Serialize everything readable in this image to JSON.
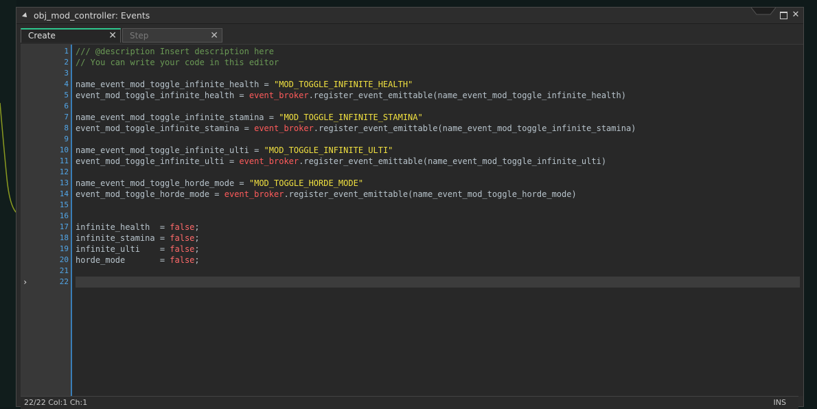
{
  "window": {
    "title": "obj_mod_controller: Events"
  },
  "tabs": [
    {
      "label": "Create",
      "close": "✕",
      "active": true
    },
    {
      "label": "Step",
      "close": "✕",
      "active": false
    }
  ],
  "editor": {
    "current_line_marker": "›",
    "lines": [
      {
        "n": "1",
        "tokens": [
          {
            "t": "/// @description Insert description here",
            "k": "comment"
          }
        ]
      },
      {
        "n": "2",
        "tokens": [
          {
            "t": "// You can write your code in this editor",
            "k": "comment"
          }
        ]
      },
      {
        "n": "3",
        "tokens": []
      },
      {
        "n": "4",
        "tokens": [
          {
            "t": "name_event_mod_toggle_infinite_health = ",
            "k": "var"
          },
          {
            "t": "\"MOD_TOGGLE_INFINITE_HEALTH\"",
            "k": "str"
          }
        ]
      },
      {
        "n": "5",
        "tokens": [
          {
            "t": "event_mod_toggle_infinite_health = ",
            "k": "var"
          },
          {
            "t": "event_broker",
            "k": "obj"
          },
          {
            "t": ".register_event_emittable(name_event_mod_toggle_infinite_health)",
            "k": "var"
          }
        ]
      },
      {
        "n": "6",
        "tokens": []
      },
      {
        "n": "7",
        "tokens": [
          {
            "t": "name_event_mod_toggle_infinite_stamina = ",
            "k": "var"
          },
          {
            "t": "\"MOD_TOGGLE_INFINITE_STAMINA\"",
            "k": "str"
          }
        ]
      },
      {
        "n": "8",
        "tokens": [
          {
            "t": "event_mod_toggle_infinite_stamina = ",
            "k": "var"
          },
          {
            "t": "event_broker",
            "k": "obj"
          },
          {
            "t": ".register_event_emittable(name_event_mod_toggle_infinite_stamina)",
            "k": "var"
          }
        ]
      },
      {
        "n": "9",
        "tokens": []
      },
      {
        "n": "10",
        "tokens": [
          {
            "t": "name_event_mod_toggle_infinite_ulti = ",
            "k": "var"
          },
          {
            "t": "\"MOD_TOGGLE_INFINITE_ULTI\"",
            "k": "str"
          }
        ]
      },
      {
        "n": "11",
        "tokens": [
          {
            "t": "event_mod_toggle_infinite_ulti = ",
            "k": "var"
          },
          {
            "t": "event_broker",
            "k": "obj"
          },
          {
            "t": ".register_event_emittable(name_event_mod_toggle_infinite_ulti)",
            "k": "var"
          }
        ]
      },
      {
        "n": "12",
        "tokens": []
      },
      {
        "n": "13",
        "tokens": [
          {
            "t": "name_event_mod_toggle_horde_mode = ",
            "k": "var"
          },
          {
            "t": "\"MOD_TOGGLE_HORDE_MODE\"",
            "k": "str"
          }
        ]
      },
      {
        "n": "14",
        "tokens": [
          {
            "t": "event_mod_toggle_horde_mode = ",
            "k": "var"
          },
          {
            "t": "event_broker",
            "k": "obj"
          },
          {
            "t": ".register_event_emittable(name_event_mod_toggle_horde_mode)",
            "k": "var"
          }
        ]
      },
      {
        "n": "15",
        "tokens": []
      },
      {
        "n": "16",
        "tokens": []
      },
      {
        "n": "17",
        "tokens": [
          {
            "t": "infinite_health  = ",
            "k": "var"
          },
          {
            "t": "false",
            "k": "kw"
          },
          {
            "t": ";",
            "k": "var"
          }
        ]
      },
      {
        "n": "18",
        "tokens": [
          {
            "t": "infinite_stamina = ",
            "k": "var"
          },
          {
            "t": "false",
            "k": "kw"
          },
          {
            "t": ";",
            "k": "var"
          }
        ]
      },
      {
        "n": "19",
        "tokens": [
          {
            "t": "infinite_ulti    = ",
            "k": "var"
          },
          {
            "t": "false",
            "k": "kw"
          },
          {
            "t": ";",
            "k": "var"
          }
        ]
      },
      {
        "n": "20",
        "tokens": [
          {
            "t": "horde_mode       = ",
            "k": "var"
          },
          {
            "t": "false",
            "k": "kw"
          },
          {
            "t": ";",
            "k": "var"
          }
        ]
      },
      {
        "n": "21",
        "tokens": []
      },
      {
        "n": "22",
        "tokens": [],
        "current": true
      }
    ]
  },
  "status": {
    "position": "22/22 Col:1 Ch:1",
    "mode": "INS"
  },
  "colors": {
    "accent_tab": "#2ec78e",
    "line_numbers": "#52a6e8",
    "string": "#f0e040",
    "keyword": "#ff6a6a",
    "comment": "#6a9955"
  }
}
